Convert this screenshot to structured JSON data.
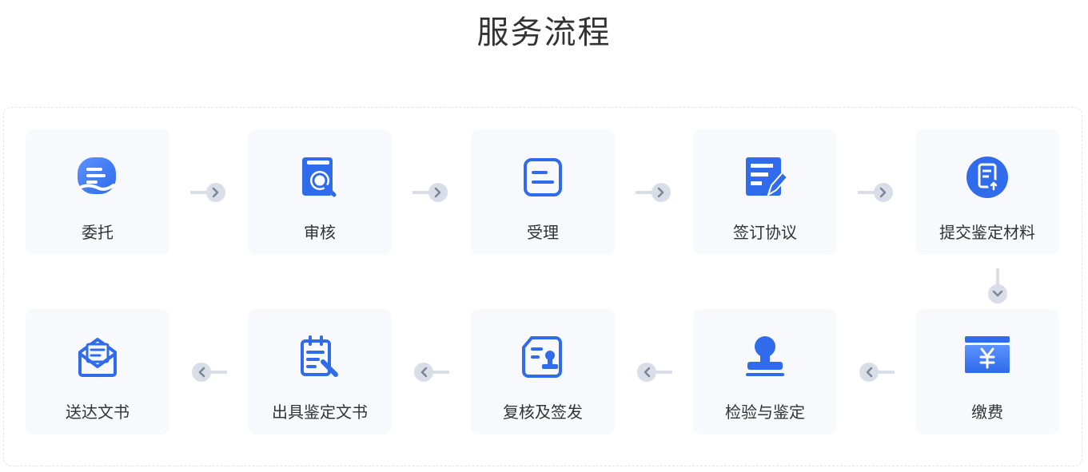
{
  "title": "服务流程",
  "steps": [
    {
      "label": "委托"
    },
    {
      "label": "审核"
    },
    {
      "label": "受理"
    },
    {
      "label": "签订协议"
    },
    {
      "label": "提交鉴定材料"
    },
    {
      "label": "缴费"
    },
    {
      "label": "检验与鉴定"
    },
    {
      "label": "复核及签发"
    },
    {
      "label": "出具鉴定文书"
    },
    {
      "label": "送达文书"
    }
  ],
  "icons": [
    "hand-card-icon",
    "search-document-icon",
    "form-icon",
    "edit-document-icon",
    "upload-document-icon",
    "yuan-wallet-icon",
    "stamp-icon",
    "certificate-stamp-icon",
    "clipboard-pen-icon",
    "envelope-letter-icon"
  ],
  "colors": {
    "accent": "#2f6bea",
    "accent_light": "#5b92ff",
    "card_bg": "#f7f9fc",
    "connector": "#d8dde8",
    "frame_border": "#e1e4ea"
  }
}
